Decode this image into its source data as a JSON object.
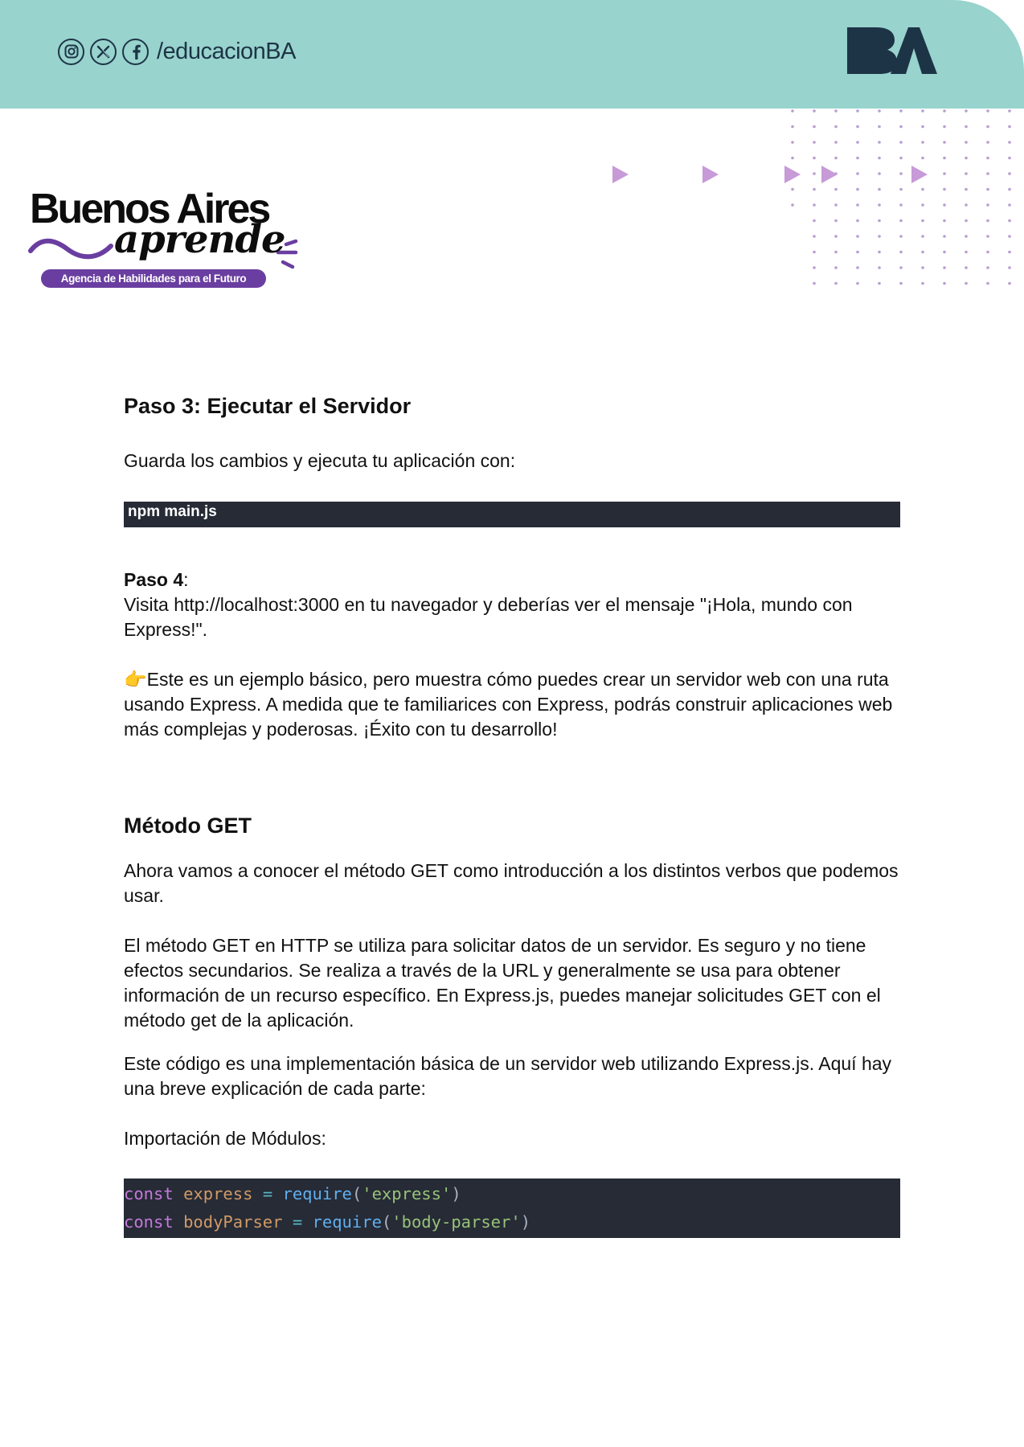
{
  "colors": {
    "header_bg": "#98d3cd",
    "brand_navy": "#1d3446",
    "brand_purple": "#6a3ea0",
    "triangle": "#c79ad8",
    "dot": "#b79ed0",
    "code_bg": "#262b36"
  },
  "header": {
    "social_icons": [
      "instagram-icon",
      "x-icon",
      "facebook-icon"
    ],
    "handle": "/educacionBA",
    "logo_text": "BA"
  },
  "brand": {
    "title": "Buenos Aires",
    "script": "aprende",
    "tagline": "Agencia de Habilidades para el Futuro"
  },
  "step3": {
    "heading": "Paso 3: Ejecutar el Servidor",
    "intro": "Guarda los cambios y ejecuta tu aplicación con:",
    "command": "npm main.js"
  },
  "step4": {
    "label": "Paso 4",
    "label_suffix": ":",
    "text": "Visita http://localhost:3000 en tu navegador y deberías ver el mensaje \"¡Hola, mundo con Express!\"."
  },
  "tip": {
    "icon": "👉",
    "text": "Este es un ejemplo básico, pero muestra cómo puedes crear un servidor web con una ruta usando Express. A medida que te familiarices con Express, podrás construir aplicaciones web más complejas y poderosas. ¡Éxito con tu desarrollo!"
  },
  "get_section": {
    "heading": "Método GET",
    "p1": "Ahora vamos a conocer el método GET como introducción a los distintos verbos que podemos usar.",
    "p2": "El método GET en HTTP se utiliza para solicitar datos de un servidor. Es seguro y no tiene efectos secundarios. Se realiza a través de la URL y generalmente se usa para obtener información de un recurso específico. En Express.js, puedes manejar solicitudes GET con el método get de la aplicación.",
    "p3": "Este código es una implementación básica de un servidor web utilizando Express.js. Aquí hay una breve explicación de cada parte:",
    "p4": "Importación de Módulos:"
  },
  "code": {
    "lines": [
      {
        "kw": "const",
        "name": "express",
        "op": "=",
        "fn": "require",
        "open": "(",
        "str": "'express'",
        "close": ")"
      },
      {
        "kw": "const",
        "name": "bodyParser",
        "op": "=",
        "fn": "require",
        "open": "(",
        "str": "'body-parser'",
        "close": ")"
      }
    ]
  }
}
